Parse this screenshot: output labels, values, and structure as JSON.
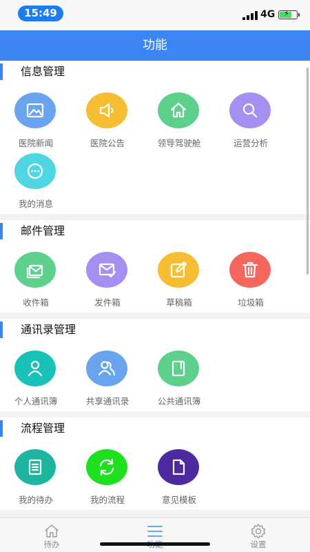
{
  "status_bar": {
    "time": "15:49",
    "network": "4G"
  },
  "nav": {
    "title": "功能"
  },
  "sections": [
    {
      "title": "信息管理",
      "items": [
        {
          "label": "医院新闻",
          "icon": "image-icon",
          "color": "#6aa3ee"
        },
        {
          "label": "医院公告",
          "icon": "megaphone-icon",
          "color": "#f7bd32"
        },
        {
          "label": "领导驾驶舱",
          "icon": "home-icon",
          "color": "#5dd08b"
        },
        {
          "label": "运营分析",
          "icon": "search-icon",
          "color": "#a58ff0"
        },
        {
          "label": "我的消息",
          "icon": "chat-icon",
          "color": "#4fd6e2"
        }
      ]
    },
    {
      "title": "邮件管理",
      "items": [
        {
          "label": "收件箱",
          "icon": "inbox-icon",
          "color": "#5dd08b"
        },
        {
          "label": "发件箱",
          "icon": "mail-sent-icon",
          "color": "#a58ff0"
        },
        {
          "label": "草稿箱",
          "icon": "edit-icon",
          "color": "#f7bd32"
        },
        {
          "label": "垃圾箱",
          "icon": "trash-icon",
          "color": "#f5675d"
        }
      ]
    },
    {
      "title": "通讯录管理",
      "items": [
        {
          "label": "个人通讯簿",
          "icon": "person-icon",
          "color": "#19c2b8"
        },
        {
          "label": "共享通讯录",
          "icon": "people-icon",
          "color": "#6aa3ee"
        },
        {
          "label": "公共通讯簿",
          "icon": "book-icon",
          "color": "#5dd08b"
        }
      ]
    },
    {
      "title": "流程管理",
      "items": [
        {
          "label": "我的待办",
          "icon": "todo-list-icon",
          "color": "#1db5a0"
        },
        {
          "label": "我的流程",
          "icon": "refresh-icon",
          "color": "#1fe01f"
        },
        {
          "label": "意见模板",
          "icon": "document-icon",
          "color": "#4d2aa0"
        }
      ]
    }
  ],
  "tabs": [
    {
      "label": "待办",
      "icon": "home-outline-icon",
      "active": false
    },
    {
      "label": "功能",
      "icon": "menu-icon",
      "active": true
    },
    {
      "label": "设置",
      "icon": "gear-icon",
      "active": false
    }
  ]
}
